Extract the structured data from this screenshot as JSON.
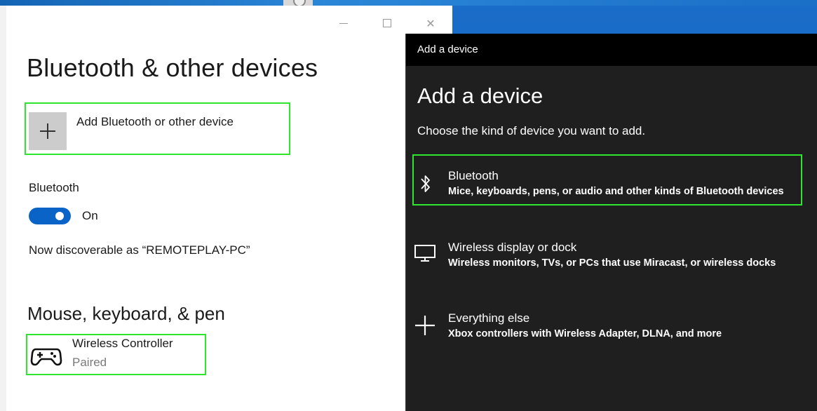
{
  "settings": {
    "page_title": "Bluetooth & other devices",
    "add_device_label": "Add Bluetooth or other device",
    "bluetooth_label": "Bluetooth",
    "toggle_state": "On",
    "discoverable_text": "Now discoverable as “REMOTEPLAY-PC”",
    "section_title": "Mouse, keyboard, & pen",
    "devices": [
      {
        "name": "Wireless Controller",
        "status": "Paired",
        "icon": "gamepad-icon"
      }
    ],
    "window_controls": {
      "minimize": "minimize-icon",
      "maximize": "maximize-icon",
      "close": "close-icon"
    }
  },
  "dialog": {
    "titlebar": "Add a device",
    "heading": "Add a device",
    "subtitle": "Choose the kind of device you want to add.",
    "options": [
      {
        "title": "Bluetooth",
        "description": "Mice, keyboards, pens, or audio and other kinds of Bluetooth devices",
        "icon": "bluetooth-icon"
      },
      {
        "title": "Wireless display or dock",
        "description": "Wireless monitors, TVs, or PCs that use Miracast, or wireless docks",
        "icon": "monitor-icon"
      },
      {
        "title": "Everything else",
        "description": "Xbox controllers with Wireless Adapter, DLNA, and more",
        "icon": "plus-icon"
      }
    ]
  },
  "colors": {
    "highlight": "#2ee62e",
    "toggle_on": "#0a64c8",
    "dialog_bg": "#1f1f1f",
    "dialog_titlebar": "#000000"
  }
}
